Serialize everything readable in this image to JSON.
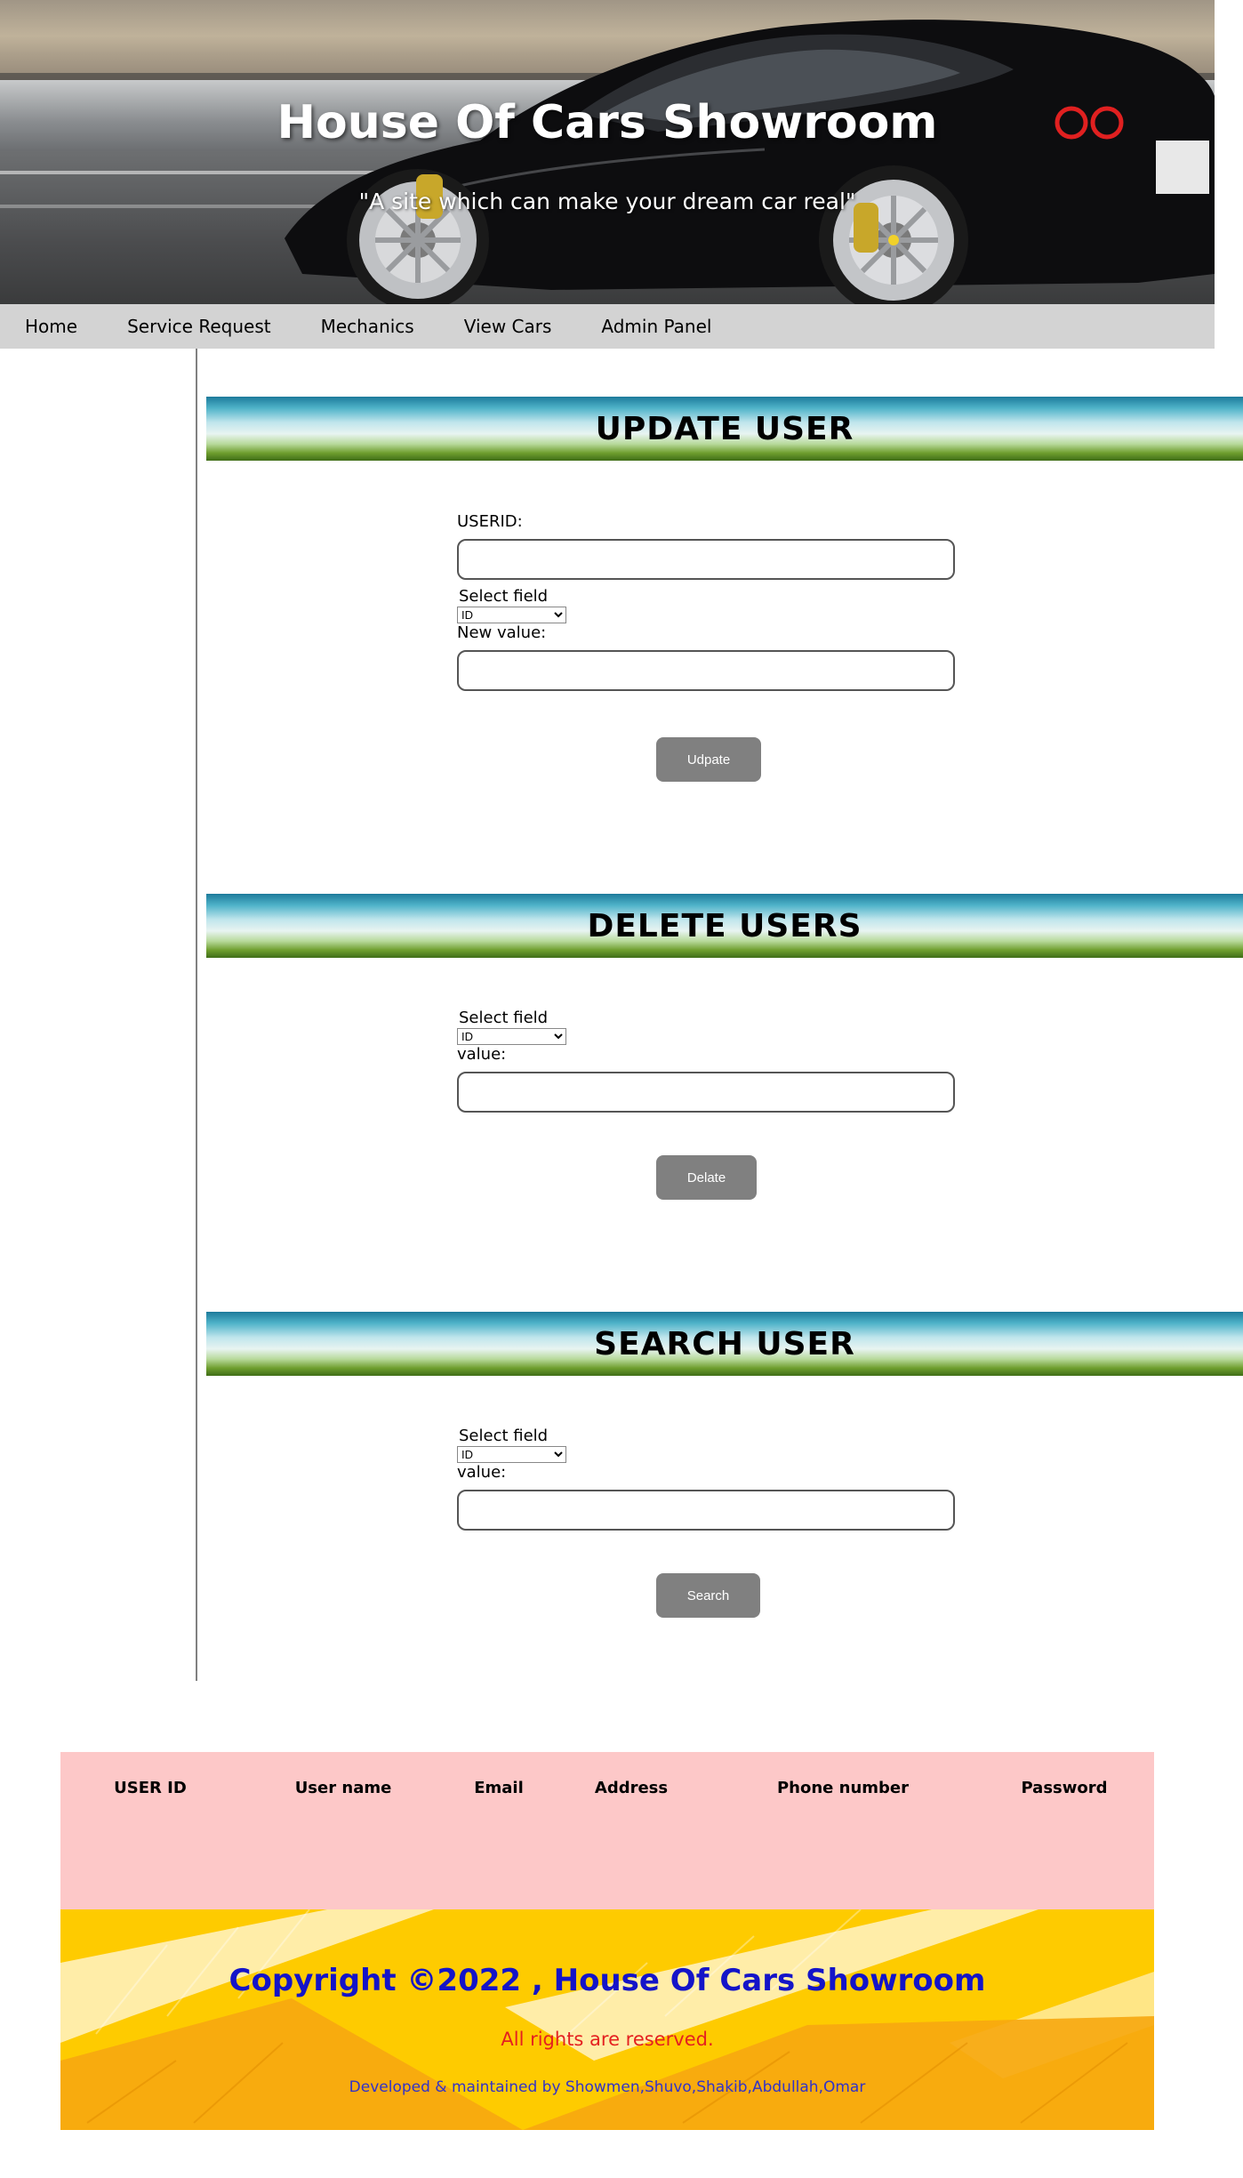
{
  "header": {
    "title": "House Of Cars Showroom",
    "tagline": "\"A site which can make your dream car real\""
  },
  "nav": {
    "items": [
      {
        "label": "Home"
      },
      {
        "label": "Service Request"
      },
      {
        "label": "Mechanics"
      },
      {
        "label": "View Cars"
      },
      {
        "label": "Admin Panel"
      }
    ]
  },
  "update_user": {
    "heading": "UPDATE USER",
    "userid_label": "USERID:",
    "select_label": "Select field",
    "select_value": "ID",
    "new_value_label": "New value:",
    "button_label": "Udpate"
  },
  "delete_users": {
    "heading": "DELETE USERS",
    "select_label": "Select field",
    "select_value": "ID",
    "value_label": "value:",
    "button_label": "Delate"
  },
  "search_user": {
    "heading": "SEARCH USER",
    "select_label": "Select field",
    "select_value": "ID",
    "value_label": "value:",
    "button_label": "Search"
  },
  "results_table": {
    "columns": [
      "USER ID",
      "User name",
      "Email",
      "Address",
      "Phone number",
      "Password"
    ]
  },
  "footer": {
    "copyright": "Copyright ©2022 , House Of Cars Showroom",
    "rights": "All rights are reserved.",
    "developers": "Developed & maintained by Showmen,Shuvo,Shakib,Abdullah,Omar"
  },
  "colors": {
    "nav_bg": "#d3d3d3",
    "button_bg": "#808080",
    "table_bg": "#fdc8c8",
    "footer_bg": "#fecb00",
    "copyright_color": "#1414c8",
    "rights_color": "#e42020"
  }
}
